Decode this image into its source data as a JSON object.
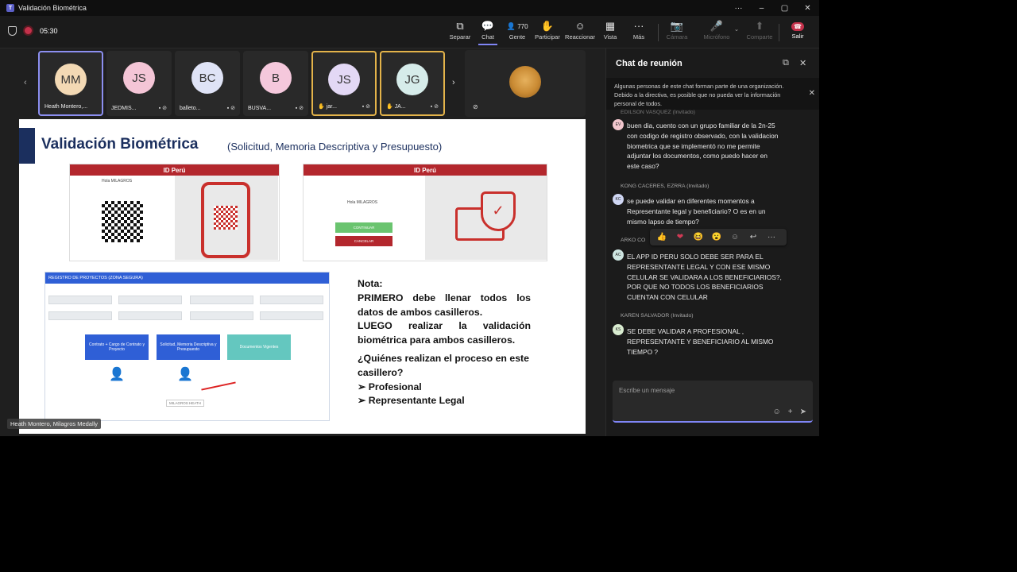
{
  "window": {
    "title": "Validación Biométrica",
    "controls": [
      "···",
      "–",
      "▢",
      "✕"
    ]
  },
  "toolbar": {
    "timer": "05:30",
    "buttons": [
      {
        "label": "Separar",
        "icon": "⧉"
      },
      {
        "label": "Chat",
        "icon": "💬"
      },
      {
        "label": "Gente",
        "icon": "👤",
        "count": "770"
      },
      {
        "label": "Participar",
        "icon": "✋"
      },
      {
        "label": "Reaccionar",
        "icon": "☺"
      },
      {
        "label": "Vista",
        "icon": "▦"
      },
      {
        "label": "Más",
        "icon": "···"
      },
      {
        "label": "Cámara",
        "icon": "📷"
      },
      {
        "label": "Micrófono",
        "icon": "🎤"
      },
      {
        "label": "Comparte",
        "icon": "⬆"
      }
    ],
    "leave_label": "Salir"
  },
  "participants": [
    {
      "initials": "MM",
      "name": "Heath Montero,...",
      "color": "#f3d9b4",
      "state": "selected"
    },
    {
      "initials": "JS",
      "name": "JEDMIS...",
      "color": "#f4c5d6",
      "state": ""
    },
    {
      "initials": "BC",
      "name": "balleto...",
      "color": "#dfe3f6",
      "state": ""
    },
    {
      "initials": "B",
      "name": "BUSVA...",
      "color": "#f5c8dc",
      "state": ""
    },
    {
      "initials": "JS",
      "name": "jar...",
      "color": "#e3d8f5",
      "state": "hand"
    },
    {
      "initials": "JG",
      "name": "JA...",
      "color": "#d6ecea",
      "state": "hand"
    }
  ],
  "slide": {
    "title": "Validación Biométrica",
    "subtitle": "(Solicitud, Memoria Descriptiva y Presupuesto)",
    "brand": "ID Perú",
    "greeting": "Hola MILAGROS",
    "btn_continue": "CONTINUAR",
    "btn_cancel": "CANCELAR",
    "reg_header": "REGISTRO DE PROYECTOS (ZONA SEGURA)",
    "reg_buttons": [
      "Contrato + Cargo de Contrato y Proyecto",
      "Solicitud, Memoria Descriptiva y Presupuesto",
      "Documentos Vigentes"
    ],
    "person_label": "MILAGROS HEATH",
    "note_title": "Nota:",
    "note_lines": [
      "PRIMERO debe llenar todos los datos de ambos casilleros.",
      "LUEGO realizar la validación biométrica para ambos casilleros."
    ],
    "question": "¿Quiénes realizan el proceso en este casillero?",
    "bullets": [
      "Profesional",
      "Representante Legal"
    ]
  },
  "speaker_label": "Heath Montero, Milagros Medally",
  "chat": {
    "title": "Chat de reunión",
    "banner": "Algunas personas de este chat forman parte de una organización. Debido a la directiva, es posible que no pueda ver la información personal de todos.",
    "messages": [
      {
        "author": "EDILSON VASQUEZ (Invitado)",
        "initials": "EV",
        "color": "#f1c6cd",
        "text": "buen dia, cuento con un grupo familiar de la 2n-25 con codigo de registro observado, con la validacion biometrica que se implementó no me permite adjuntar los documentos, como puedo hacer en este caso?"
      },
      {
        "author": "KONG CACERES, EZRRA (Invitado)",
        "initials": "KC",
        "color": "#cfd6f3",
        "text": "se puede validar en diferentes momentos a Representante legal y beneficiario? O es en un mismo lapso de tiempo?"
      },
      {
        "author": "ARKO CO",
        "initials": "AC",
        "color": "#cfe6e2",
        "text": "EL APP ID PERU SOLO DEBE SER PARA EL REPRESENTANTE LEGAL Y CON ESE MISMO CELULAR SE VALIDARA A LOS BENEFICIARIOS?, POR QUE NO TODOS LOS BENEFICIARIOS CUENTAN CON CELULAR"
      },
      {
        "author": "KAREN SALVADOR (Invitado)",
        "initials": "KS",
        "color": "#d9ecd0",
        "text": "SE DEBE VALIDAR A PROFESIONAL , REPRESENTANTE Y BENEFICIARIO AL MISMO TIEMPO ?"
      }
    ],
    "reactions": [
      "👍",
      "❤",
      "😆",
      "😮",
      "☺",
      "↩",
      "···"
    ],
    "compose_placeholder": "Escribe un mensaje"
  }
}
